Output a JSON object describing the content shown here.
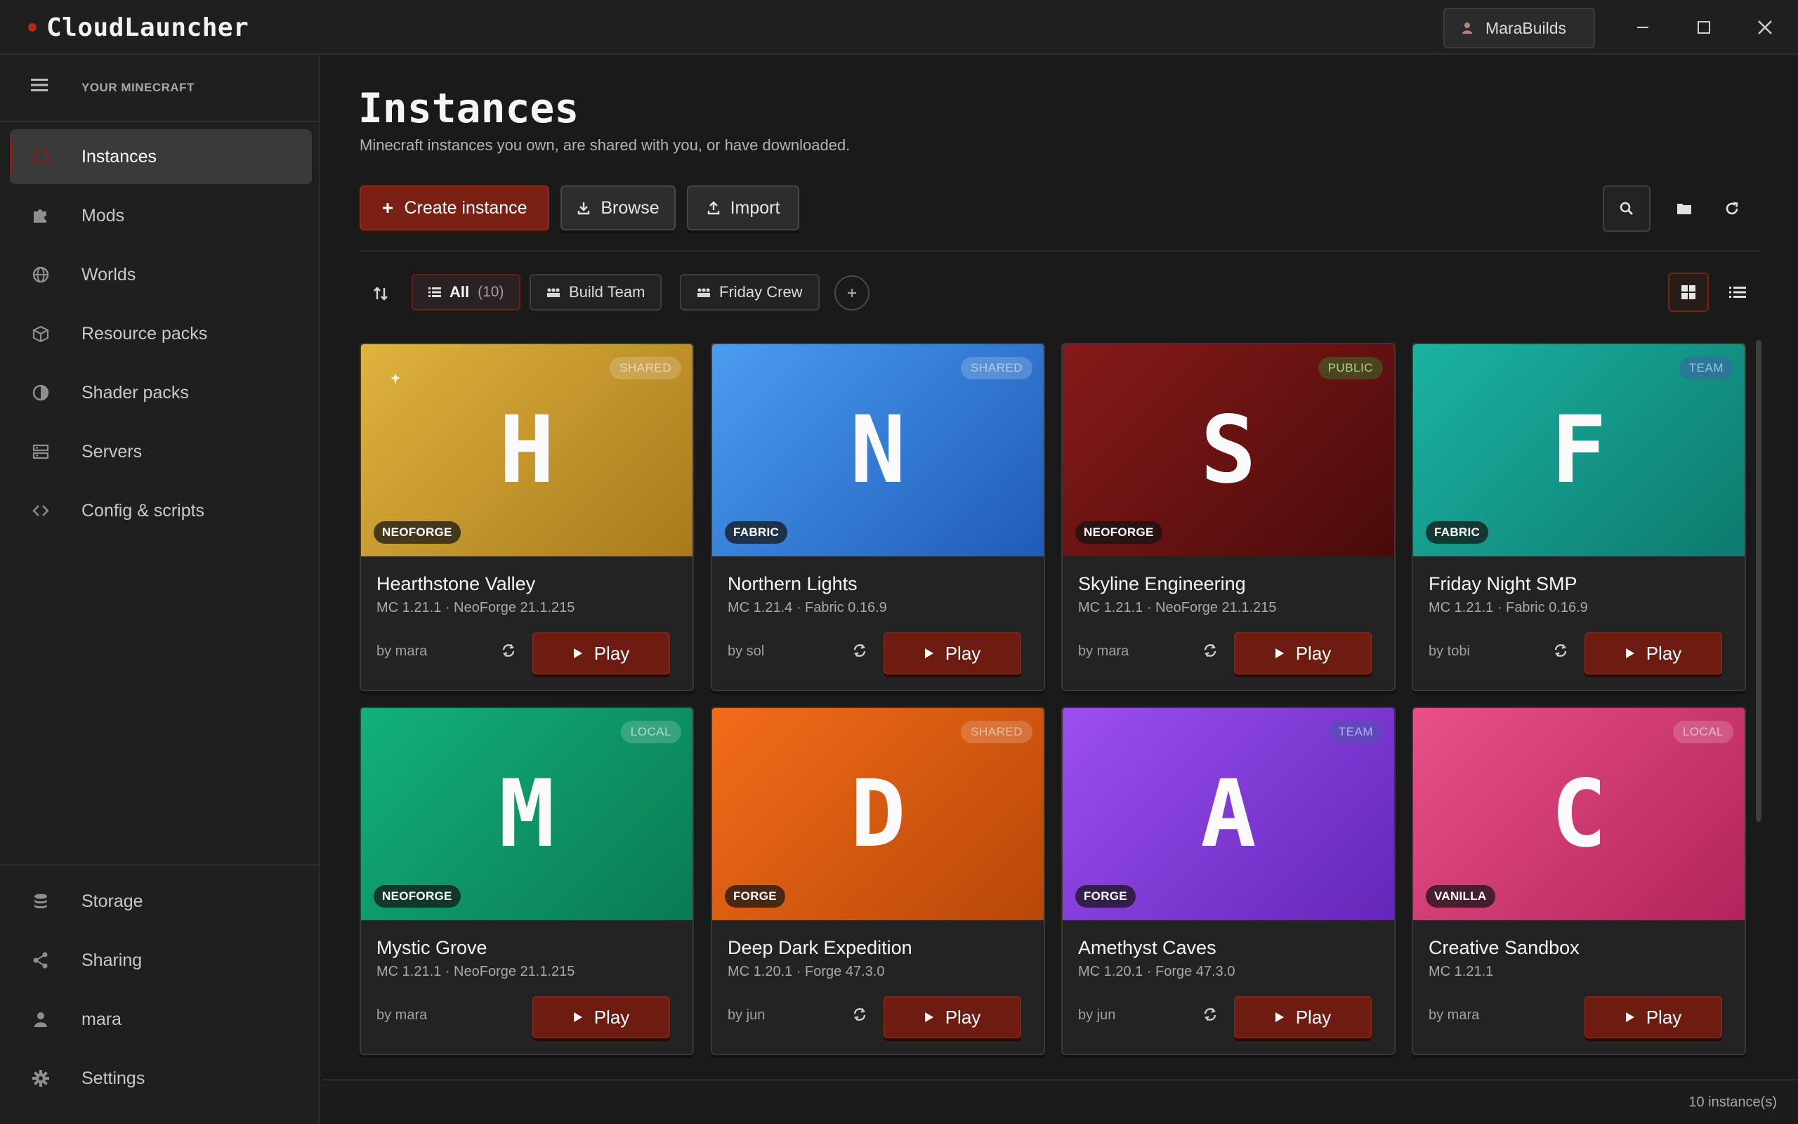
{
  "app": {
    "name": "CloudLauncher",
    "brand_color": "#b3261e"
  },
  "account": {
    "username": "MaraBuilds"
  },
  "window_controls": [
    "minimize-icon",
    "maximize-icon",
    "close-icon"
  ],
  "sidebar": {
    "section_label": "YOUR MINECRAFT",
    "items": [
      {
        "label": "Instances",
        "icon": "instances-icon",
        "active": true
      },
      {
        "label": "Mods",
        "icon": "puzzle-icon"
      },
      {
        "label": "Worlds",
        "icon": "globe-icon"
      },
      {
        "label": "Resource packs",
        "icon": "package-icon"
      },
      {
        "label": "Shader packs",
        "icon": "contrast-icon"
      },
      {
        "label": "Servers",
        "icon": "server-icon"
      },
      {
        "label": "Config & scripts",
        "icon": "code-icon"
      }
    ],
    "bottom_items": [
      {
        "label": "Storage",
        "icon": "database-icon"
      },
      {
        "label": "Sharing",
        "icon": "share-icon"
      },
      {
        "label": "mara",
        "icon": "user-icon"
      },
      {
        "label": "Settings",
        "icon": "gear-icon"
      }
    ]
  },
  "main": {
    "title": "Instances",
    "subtitle": "Minecraft instances you own, are shared with you, or have downloaded.",
    "actions": {
      "create": "Create instance",
      "browse": "Browse",
      "import": "Import"
    },
    "tools": [
      "search-icon",
      "folder-icon",
      "refresh-icon"
    ],
    "filters": {
      "all_label": "All",
      "all_count": "(10)",
      "groups": [
        "Build Team",
        "Friday Crew"
      ]
    },
    "view_modes": [
      "grid-view-icon",
      "list-view-icon"
    ],
    "play_label": "Play",
    "footer_count": "10 instance(s)"
  },
  "instances": [
    {
      "letter": "H",
      "name": "Hearthstone Valley",
      "meta": "MC 1.21.1 · NeoForge 21.1.215",
      "author": "by mara",
      "loader": "NEOFORGE",
      "visibility": "SHARED",
      "pinned": true,
      "sync": true,
      "colors": [
        "#e0b23e",
        "#a87a1c"
      ]
    },
    {
      "letter": "N",
      "name": "Northern Lights",
      "meta": "MC 1.21.4 · Fabric 0.16.9",
      "author": "by sol",
      "loader": "FABRIC",
      "visibility": "SHARED",
      "sync": true,
      "colors": [
        "#4b9cf0",
        "#1f5bb8"
      ]
    },
    {
      "letter": "S",
      "name": "Skyline Engineering",
      "meta": "MC 1.21.1 · NeoForge 21.1.215",
      "author": "by mara",
      "loader": "NEOFORGE",
      "visibility": "PUBLIC",
      "sync": true,
      "colors": [
        "#861a1a",
        "#4a0a0a"
      ]
    },
    {
      "letter": "F",
      "name": "Friday Night SMP",
      "meta": "MC 1.21.1 · Fabric 0.16.9",
      "author": "by tobi",
      "loader": "FABRIC",
      "visibility": "TEAM",
      "sync": true,
      "colors": [
        "#1bb3a2",
        "#0d7a6e"
      ]
    },
    {
      "letter": "M",
      "name": "Mystic Grove",
      "meta": "MC 1.21.1 · NeoForge 21.1.215",
      "author": "by mara",
      "loader": "NEOFORGE",
      "visibility": "LOCAL",
      "sync": false,
      "colors": [
        "#13b07c",
        "#0a7a52"
      ]
    },
    {
      "letter": "D",
      "name": "Deep Dark Expedition",
      "meta": "MC 1.20.1 · Forge 47.3.0",
      "author": "by jun",
      "loader": "FORGE",
      "visibility": "SHARED",
      "sync": true,
      "colors": [
        "#f26c1a",
        "#b84708"
      ]
    },
    {
      "letter": "A",
      "name": "Amethyst Caves",
      "meta": "MC 1.20.1 · Forge 47.3.0",
      "author": "by jun",
      "loader": "FORGE",
      "visibility": "TEAM",
      "sync": true,
      "colors": [
        "#9b4ff0",
        "#6426b8"
      ]
    },
    {
      "letter": "C",
      "name": "Creative Sandbox",
      "meta": "MC 1.21.1",
      "author": "by mara",
      "loader": "VANILLA",
      "visibility": "LOCAL",
      "sync": false,
      "colors": [
        "#ea4f88",
        "#b1245a"
      ]
    }
  ]
}
